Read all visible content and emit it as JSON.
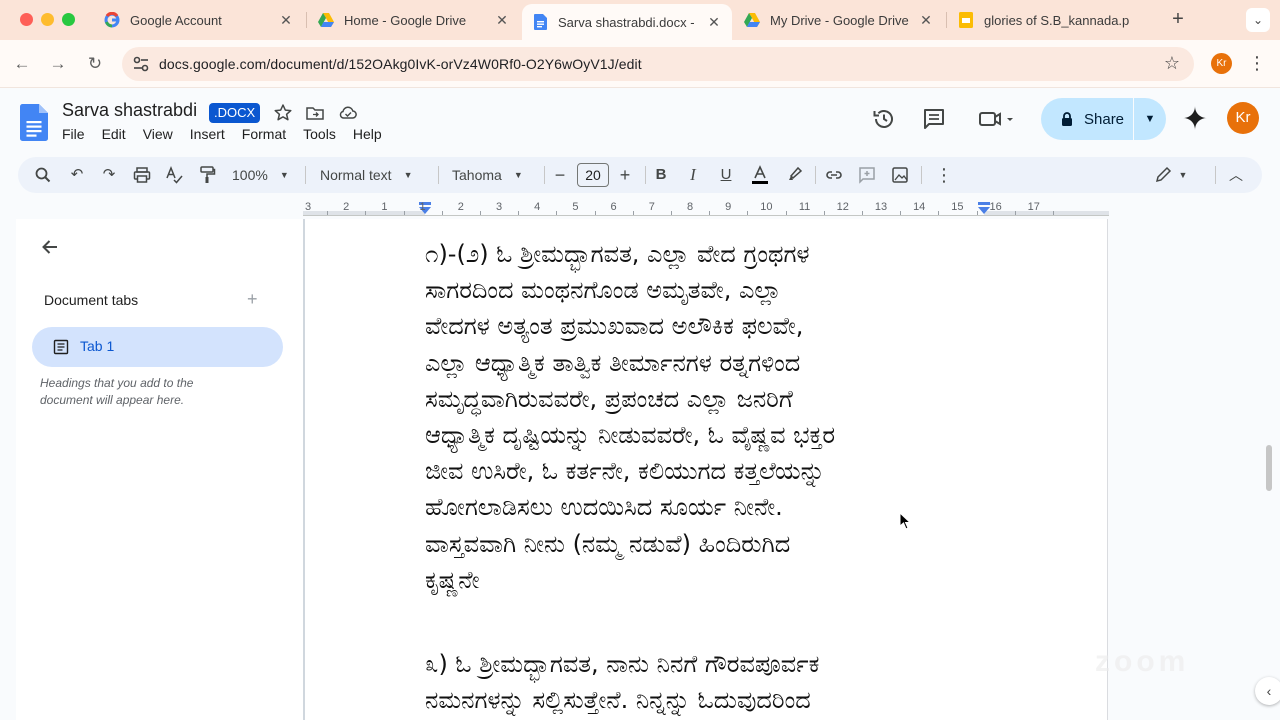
{
  "browser": {
    "tabs": [
      {
        "title": "Google Account",
        "favicon": "google-g-icon",
        "active": false
      },
      {
        "title": "Home - Google Drive",
        "favicon": "google-drive-icon",
        "active": false
      },
      {
        "title": "Sarva shastrabdi.docx -",
        "favicon": "google-docs-icon",
        "active": true
      },
      {
        "title": "My Drive - Google Drive",
        "favicon": "google-drive-icon",
        "active": false
      },
      {
        "title": "glories of S.B_kannada.p",
        "favicon": "google-slides-icon",
        "active": false
      }
    ],
    "new_tab": "+",
    "tab_menu": "⌄",
    "url": "docs.google.com/document/d/152OAkg0IvK-orVz4W0Rf0-O2Y6wOyV1J/edit",
    "profile_initials": "Kr"
  },
  "docs": {
    "title": "Sarva shastrabdi",
    "badge": ".DOCX",
    "menu": [
      "File",
      "Edit",
      "View",
      "Insert",
      "Format",
      "Tools",
      "Help"
    ],
    "share_label": "Share",
    "avatar_initials": "Kr"
  },
  "toolbar": {
    "zoom": "100%",
    "style": "Normal text",
    "font": "Tahoma",
    "font_size": "20"
  },
  "ruler": {
    "labels": [
      "3",
      "2",
      "1",
      "1",
      "2",
      "3",
      "4",
      "5",
      "6",
      "7",
      "8",
      "9",
      "10",
      "11",
      "12",
      "13",
      "14",
      "15",
      "16",
      "17"
    ]
  },
  "sidebar": {
    "heading": "Document tabs",
    "add": "+",
    "tab_label": "Tab 1",
    "hint": "Headings that you add to the document will appear here."
  },
  "document": {
    "paragraph1": [
      "೧)-(೨) ಓ ಶ್ರೀಮದ್ಭಾಗವತ, ಎಲ್ಲಾ ವೇದ ಗ್ರಂಥಗಳ",
      "ಸಾಗರದಿಂದ ಮಂಥನಗೊಂಡ ಅಮೃತವೇ, ಎಲ್ಲಾ",
      "ವೇದಗಳ ಅತ್ಯಂತ ಪ್ರಮುಖವಾದ ಅಲೌಕಿಕ ಫಲವೇ,",
      "ಎಲ್ಲಾ ಆಧ್ಯಾತ್ಮಿಕ ತಾತ್ವಿಕ ತೀರ್ಮಾನಗಳ ರತ್ನಗಳಿಂದ",
      "ಸಮೃದ್ಧವಾಗಿರುವವರೇ, ಪ್ರಪಂಚದ ಎಲ್ಲಾ ಜನರಿಗೆ",
      "ಆಧ್ಯಾತ್ಮಿಕ ದೃಷ್ಟಿಯನ್ನು ನೀಡುವವರೇ, ಓ ವೈಷ್ಣವ ಭಕ್ತರ",
      "ಜೀವ ಉಸಿರೇ, ಓ ಕರ್ತನೇ, ಕಲಿಯುಗದ ಕತ್ತಲೆಯನ್ನು",
      "ಹೋಗಲಾಡಿಸಲು ಉದಯಿಸಿದ ಸೂರ್ಯ ನೀನೇ.",
      "ವಾಸ್ತವವಾಗಿ ನೀನು (ನಮ್ಮ ನಡುವೆ) ಹಿಂದಿರುಗಿದ",
      "ಕೃಷ್ಣನೇ"
    ],
    "paragraph2": [
      "೩) ಓ ಶ್ರೀಮದ್ಭಾಗವತ, ನಾನು ನಿನಗೆ ಗೌರವಪೂರ್ವಕ",
      "ನಮನಗಳನ್ನು ಸಲ್ಲಿಸುತ್ತೇನೆ. ನಿನ್ನನ್ನು ಓದುವುದರಿಂದ"
    ]
  },
  "watermark": "zoom",
  "colors": {
    "tabstrip": "#fbe4d8",
    "docs_blue": "#0b57d0",
    "share_bg": "#c2e7ff",
    "avatar": "#e8710a"
  }
}
